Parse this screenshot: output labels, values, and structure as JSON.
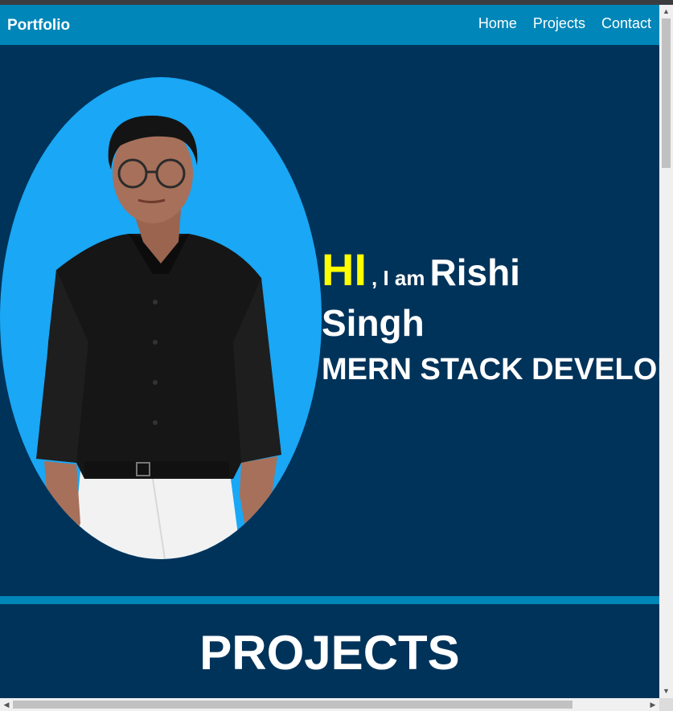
{
  "nav": {
    "brand": "Portfolio",
    "links": [
      "Home",
      "Projects",
      "Contact"
    ]
  },
  "hero": {
    "greeting": "HI",
    "intro": ", I am",
    "first_name": "Rishi",
    "last_name": "Singh",
    "role": "MERN STACK DEVELOPER",
    "photo_icon": "profile-photo"
  },
  "projects": {
    "title": "PROJECTS"
  },
  "colors": {
    "navbar": "#0086b8",
    "background": "#00335a",
    "photo_backdrop": "#1aa7f5",
    "greeting": "#ffff00",
    "text": "#ffffff"
  },
  "scrollbars": {
    "vertical_up_icon": "triangle-up-icon",
    "vertical_down_icon": "triangle-down-icon",
    "horizontal_left_icon": "triangle-left-icon",
    "horizontal_right_icon": "triangle-right-icon"
  }
}
